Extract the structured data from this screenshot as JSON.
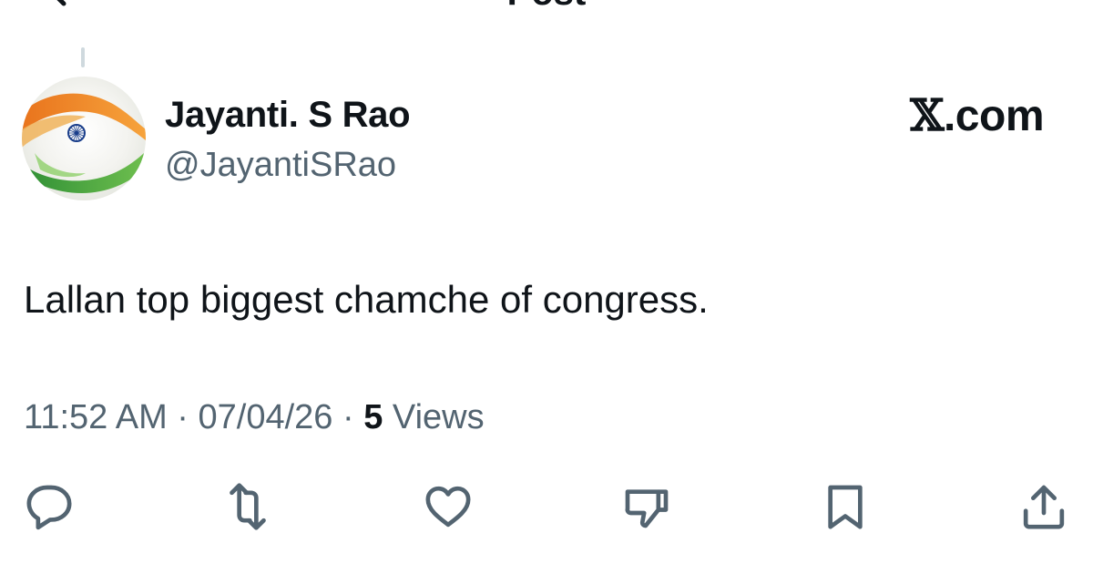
{
  "header": {
    "title": "Post"
  },
  "post": {
    "author": {
      "display_name": "Jayanti. S Rao",
      "handle": "@JayantiSRao"
    },
    "brand": {
      "mark": "𝕏",
      "suffix": ".com"
    },
    "text": "Lallan top biggest chamche of congress.",
    "meta": {
      "time": "11:52 AM",
      "separator": "·",
      "date": "07/04/26",
      "views_count": "5",
      "views_label": "Views"
    }
  },
  "actions": [
    {
      "icon": "reply-icon"
    },
    {
      "icon": "repost-icon"
    },
    {
      "icon": "like-icon"
    },
    {
      "icon": "dislike-icon"
    },
    {
      "icon": "bookmark-icon"
    },
    {
      "icon": "share-icon"
    }
  ],
  "colors": {
    "text_primary": "#0f1419",
    "text_secondary": "#536471",
    "saffron": "#f28c28",
    "green": "#3c9a3c",
    "chakra_blue": "#1b3f8b"
  }
}
